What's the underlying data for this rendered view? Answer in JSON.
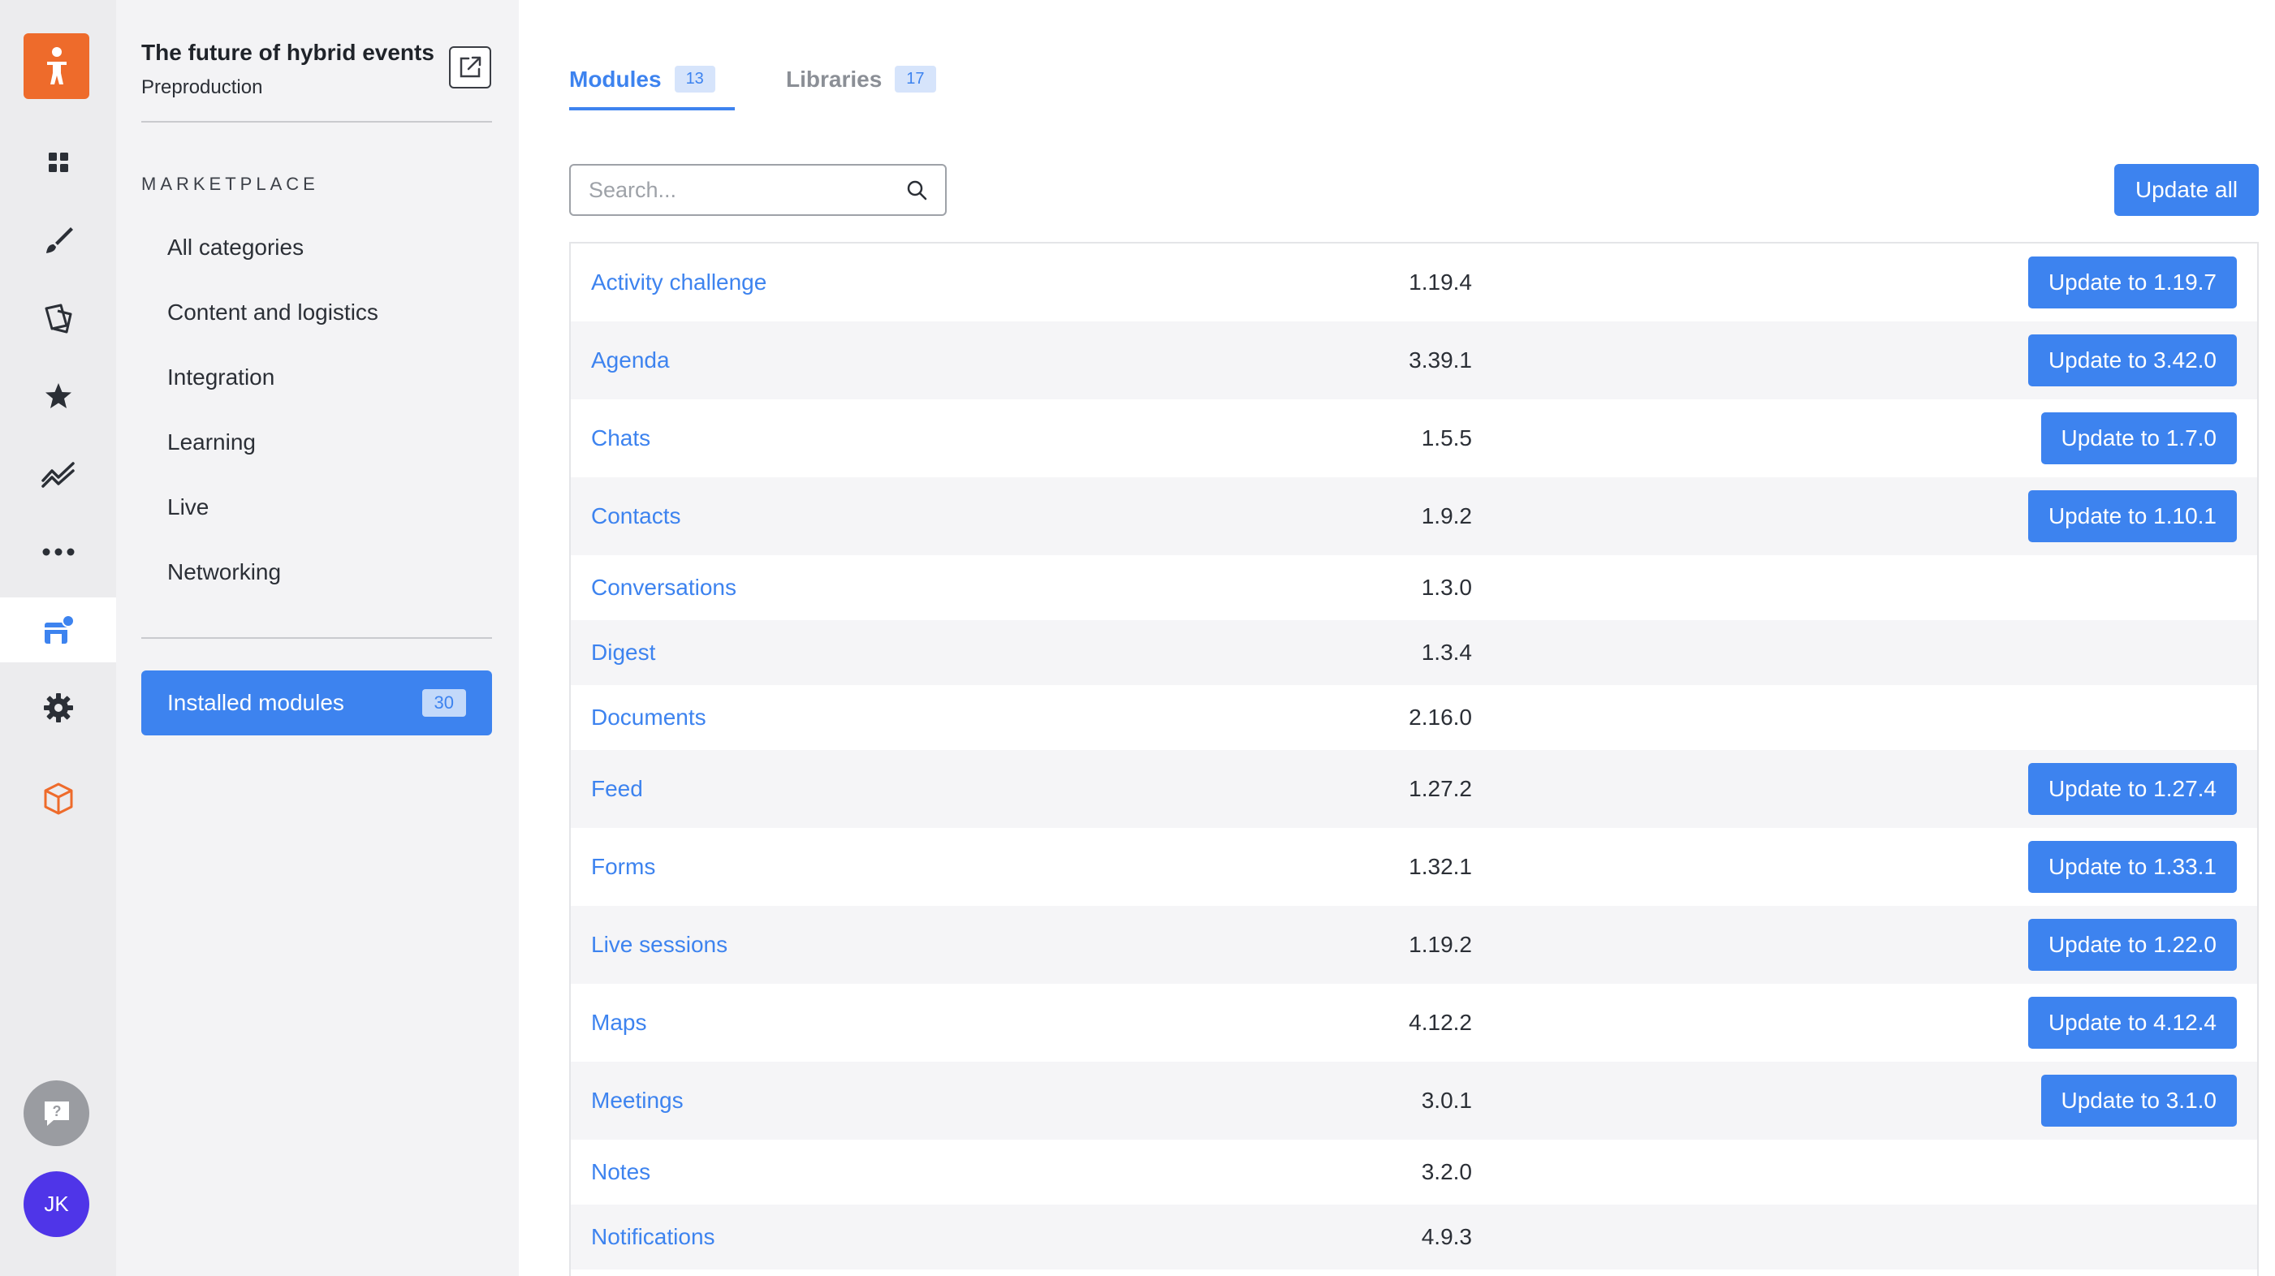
{
  "rail": {
    "logo_icon": "person-logo-icon",
    "items": [
      {
        "icon": "dashboard-icon"
      },
      {
        "icon": "brush-icon"
      },
      {
        "icon": "pages-icon"
      },
      {
        "icon": "star-icon"
      },
      {
        "icon": "analytics-icon"
      },
      {
        "icon": "more-icon"
      },
      {
        "icon": "marketplace-icon",
        "active": true
      },
      {
        "icon": "gear-icon"
      },
      {
        "icon": "cube-icon"
      }
    ],
    "help_icon": "help-icon",
    "avatar_initials": "JK"
  },
  "sidebar": {
    "event_title": "The future of hybrid events",
    "event_status": "Preproduction",
    "marketplace_heading": "MARKETPLACE",
    "categories": [
      {
        "label": "All categories"
      },
      {
        "label": "Content and logistics"
      },
      {
        "label": "Integration"
      },
      {
        "label": "Learning"
      },
      {
        "label": "Live"
      },
      {
        "label": "Networking"
      }
    ],
    "installed": {
      "label": "Installed modules",
      "count": "30"
    }
  },
  "main": {
    "tabs": [
      {
        "label": "Modules",
        "count": "13",
        "active": true
      },
      {
        "label": "Libraries",
        "count": "17",
        "active": false
      }
    ],
    "search": {
      "placeholder": "Search...",
      "value": ""
    },
    "update_all_label": "Update all",
    "modules": [
      {
        "name": "Activity challenge",
        "version": "1.19.4",
        "update": "Update to 1.19.7"
      },
      {
        "name": "Agenda",
        "version": "3.39.1",
        "update": "Update to 3.42.0"
      },
      {
        "name": "Chats",
        "version": "1.5.5",
        "update": "Update to 1.7.0"
      },
      {
        "name": "Contacts",
        "version": "1.9.2",
        "update": "Update to 1.10.1"
      },
      {
        "name": "Conversations",
        "version": "1.3.0",
        "update": ""
      },
      {
        "name": "Digest",
        "version": "1.3.4",
        "update": ""
      },
      {
        "name": "Documents",
        "version": "2.16.0",
        "update": ""
      },
      {
        "name": "Feed",
        "version": "1.27.2",
        "update": "Update to 1.27.4"
      },
      {
        "name": "Forms",
        "version": "1.32.1",
        "update": "Update to 1.33.1"
      },
      {
        "name": "Live sessions",
        "version": "1.19.2",
        "update": "Update to 1.22.0"
      },
      {
        "name": "Maps",
        "version": "4.12.2",
        "update": "Update to 4.12.4"
      },
      {
        "name": "Meetings",
        "version": "3.0.1",
        "update": "Update to 3.1.0"
      },
      {
        "name": "Notes",
        "version": "3.2.0",
        "update": ""
      },
      {
        "name": "Notifications",
        "version": "4.9.3",
        "update": ""
      }
    ]
  },
  "colors": {
    "accent": "#3d83ef",
    "brand": "#ee6b2b",
    "avatar": "#4f35e8"
  }
}
